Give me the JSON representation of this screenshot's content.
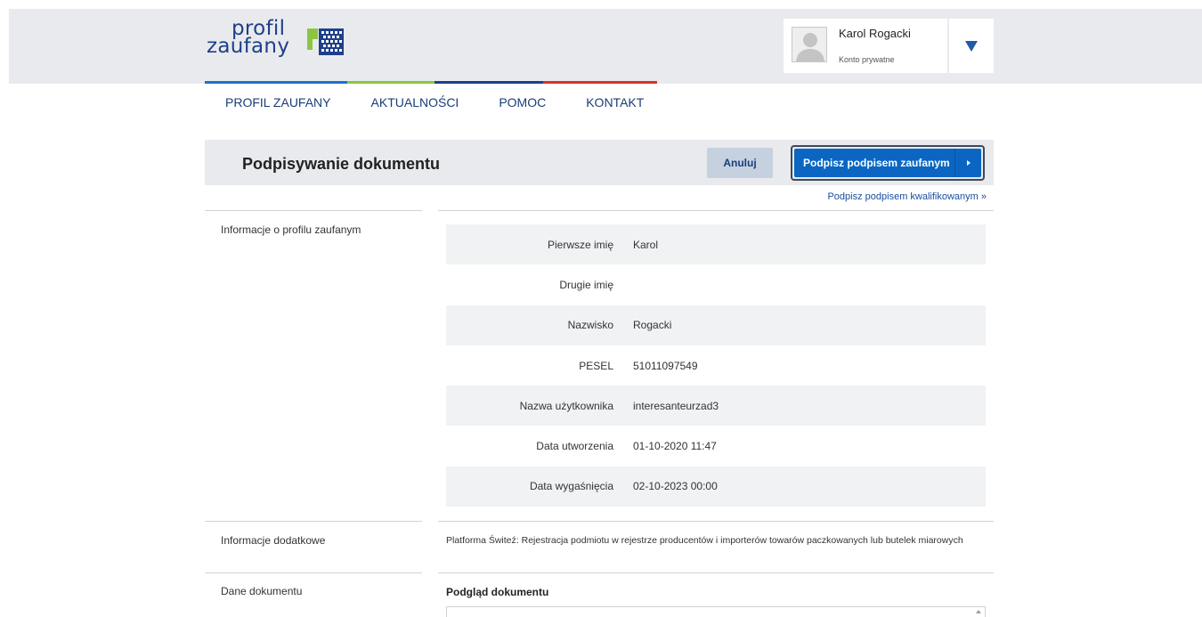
{
  "brand": {
    "logo_line1": "profil",
    "logo_line2": "zaufany",
    "colors": {
      "navy": "#1f3f8a",
      "green": "#8cc63f",
      "blue": "#0a66c2",
      "red": "#d9322b"
    }
  },
  "user": {
    "name": "Karol Rogacki",
    "account_type": "Konto prywatne",
    "menu_icon": "caret-down-icon"
  },
  "nav": {
    "items": [
      {
        "label": "PROFIL ZAUFANY"
      },
      {
        "label": "AKTUALNOŚCI"
      },
      {
        "label": "POMOC"
      },
      {
        "label": "KONTAKT"
      }
    ]
  },
  "toolbar": {
    "title": "Podpisywanie dokumentu",
    "cancel_label": "Anuluj",
    "sign_label": "Podpisz podpisem zaufanym",
    "qualified_link": "Podpisz podpisem kwalifikowanym »"
  },
  "profile_info": {
    "section_label": "Informacje o profilu zaufanym",
    "rows": [
      {
        "label": "Pierwsze imię",
        "value": "Karol"
      },
      {
        "label": "Drugie imię",
        "value": ""
      },
      {
        "label": "Nazwisko",
        "value": "Rogacki"
      },
      {
        "label": "PESEL",
        "value": "51011097549"
      },
      {
        "label": "Nazwa użytkownika",
        "value": "interesanteurzad3"
      },
      {
        "label": "Data utworzenia",
        "value": "01-10-2020 11:47"
      },
      {
        "label": "Data wygaśnięcia",
        "value": "02-10-2023 00:00"
      }
    ]
  },
  "additional_info": {
    "section_label": "Informacje dodatkowe",
    "text": "Platforma Świteź: Rejestracja podmiotu w rejestrze producentów i importerów towarów paczkowanych lub butelek miarowych"
  },
  "document": {
    "section_label": "Dane dokumentu",
    "preview_title": "Podgląd dokumentu"
  }
}
